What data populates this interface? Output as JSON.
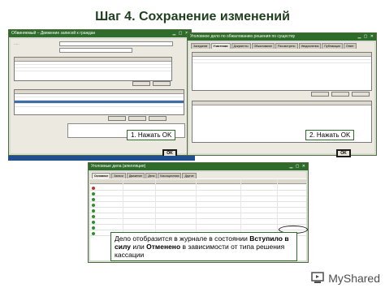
{
  "slide": {
    "title": "Шаг 4. Сохранение изменений"
  },
  "left_window": {
    "title": "Обвиняемый – Движение записей к граждан"
  },
  "right_window": {
    "title": "Уголовное дело по обжалованию решения по существу",
    "tabs": [
      "Заседание",
      "Участники",
      "Документы",
      "Обжалование",
      "Рассмотрено",
      "Уведомления",
      "Публикация",
      "Ответ"
    ]
  },
  "bottom_window": {
    "title": "Уголовные дела (апелляция)",
    "tabs": [
      "Основное",
      "Записи",
      "Движение",
      "Дела",
      "Кассационная",
      "Другое"
    ]
  },
  "callouts": {
    "first": "1. Нажать OK",
    "second": "2. Нажать OK"
  },
  "ok_buttons": {
    "left": "OK",
    "right": "OK"
  },
  "note": {
    "part1": "Дело отобразится в журнале в состоянии ",
    "bold1": "Вступило в силу",
    "part2": " или ",
    "bold2": "Отменено",
    "part3": " в зависимости от типа решения кассации"
  },
  "watermark": {
    "text": "MyShared"
  },
  "colors": {
    "window_title": "#2f6b2a",
    "selection": "#3d6ea8",
    "title_text": "#1f3f1f"
  }
}
